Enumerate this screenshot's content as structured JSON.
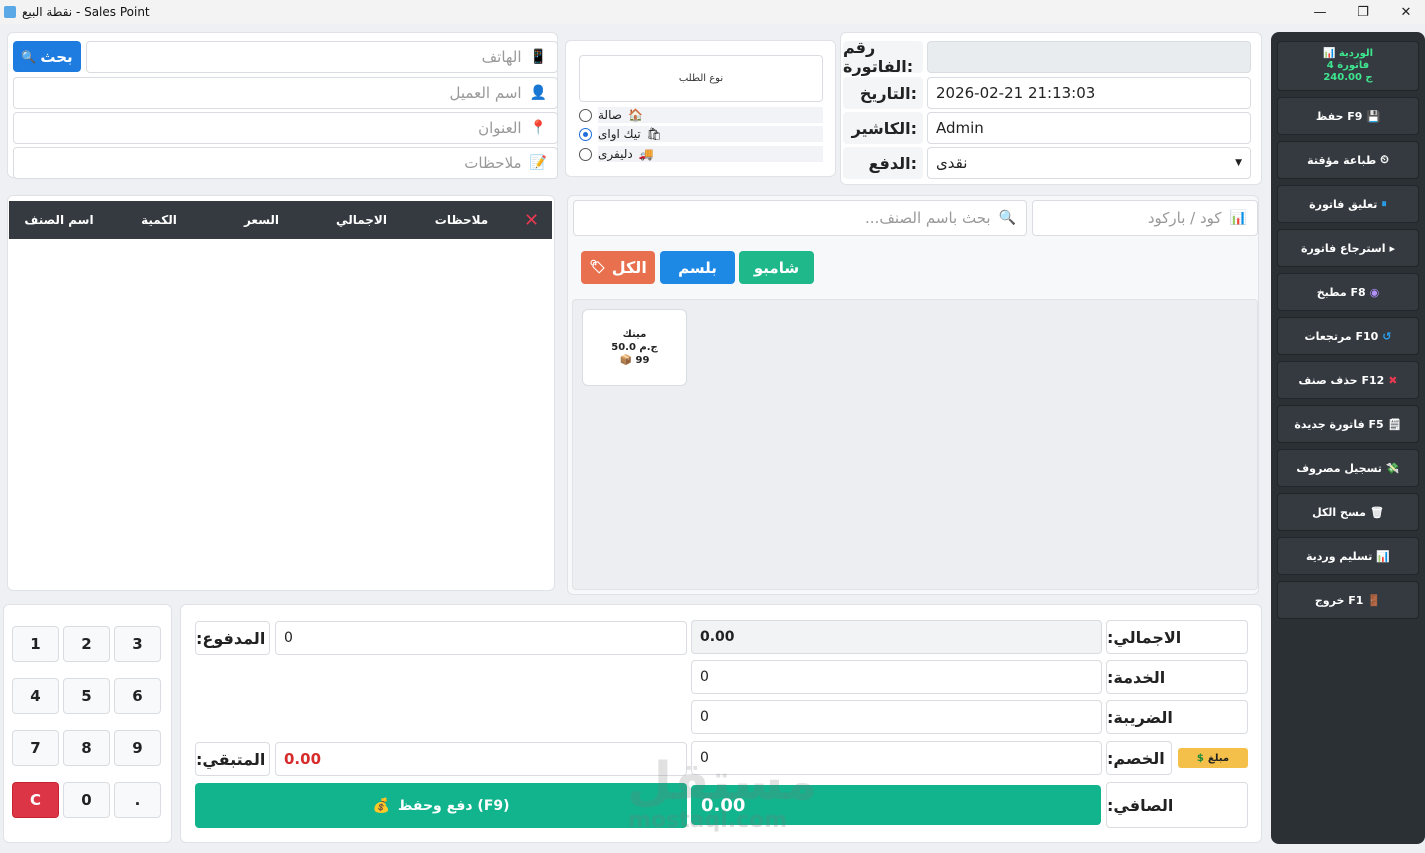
{
  "window": {
    "title": "نقطة البيع - Sales Point",
    "minimize": "—",
    "maximize": "❐",
    "close": "✕"
  },
  "customer": {
    "phone_placeholder": "الهاتف",
    "search_button": "بحث",
    "name_placeholder": "اسم العميل",
    "address_placeholder": "العنوان",
    "notes_placeholder": "ملاحظات"
  },
  "order_type": {
    "title": "نوع الطلب",
    "options": [
      {
        "label": "صالة",
        "selected": false
      },
      {
        "label": "تيك اواى",
        "selected": true
      },
      {
        "label": "دليفرى",
        "selected": false
      }
    ]
  },
  "invoice": {
    "number_label": "رقم الفاتورة:",
    "number_value": "",
    "date_label": "التاريخ:",
    "date_value": "2026-02-21 21:13:03",
    "cashier_label": "الكاشير:",
    "cashier_value": "Admin",
    "payment_label": "الدفع:",
    "payment_value": "نقدى"
  },
  "cart_table": {
    "columns": [
      "اسم الصنف",
      "الكمية",
      "السعر",
      "الاجمالي",
      "ملاحظات"
    ],
    "clear_icon": "✕"
  },
  "product_search": {
    "barcode_placeholder": "كود / باركود",
    "name_placeholder": "بحث باسم الصنف..."
  },
  "categories": [
    {
      "label": "الكل",
      "color": "#e8704e"
    },
    {
      "label": "بلسم",
      "color": "#1e88e5"
    },
    {
      "label": "شامبو",
      "color": "#1fb88a"
    }
  ],
  "products": [
    {
      "name": "مينك",
      "price": "50.0 ج.م",
      "stock": "99"
    }
  ],
  "sidebar": {
    "shift": {
      "title": "الوردية",
      "invoices": "4 فاتورة",
      "amount": "240.00 ج"
    },
    "buttons": [
      {
        "label": "F9 حفظ",
        "icon": "💾"
      },
      {
        "label": "طباعة مؤقتة",
        "icon": "⏲"
      },
      {
        "label": "تعليق فاتورة",
        "icon": "⏸"
      },
      {
        "label": "استرجاع فاتورة",
        "icon": "▸"
      },
      {
        "label": "F8 مطبخ",
        "icon": "◉"
      },
      {
        "label": "F10 مرتجعات",
        "icon": "↺"
      },
      {
        "label": "F12 حذف صنف",
        "icon": "✖"
      },
      {
        "label": "F5 فاتورة جديدة",
        "icon": "🗒"
      },
      {
        "label": "تسجيل مصروف",
        "icon": "💸"
      },
      {
        "label": "مسح الكل",
        "icon": "🗑"
      },
      {
        "label": "تسليم وردية",
        "icon": "📊"
      },
      {
        "label": "F1 خروج",
        "icon": "🚪"
      }
    ]
  },
  "keypad": [
    "1",
    "2",
    "3",
    "4",
    "5",
    "6",
    "7",
    "8",
    "9",
    "C",
    "0",
    "."
  ],
  "totals": {
    "total_label": "الاجمالي:",
    "total_value": "0.00",
    "service_label": "الخدمة:",
    "service_value": "0",
    "tax_label": "الضريبة:",
    "tax_value": "0",
    "discount_label": "الخصم:",
    "discount_value": "0",
    "discount_type": "مبلغ",
    "net_label": "الصافي:",
    "net_value": "0.00",
    "paid_label": "المدفوع:",
    "paid_value": "0",
    "remaining_label": "المتبقي:",
    "remaining_value": "0.00",
    "pay_save_button": "دفع وحفظ (F9)"
  },
  "watermark": {
    "text": "مستقل",
    "sub": "mostaql.com"
  }
}
